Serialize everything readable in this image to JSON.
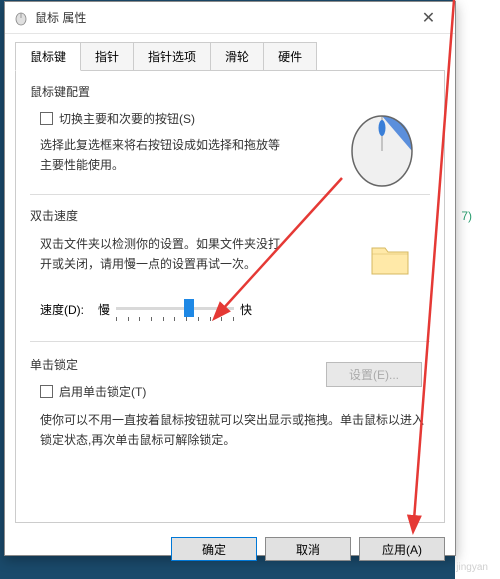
{
  "bg": {
    "hint": "7)"
  },
  "window": {
    "title": "鼠标 属性",
    "close": "✕"
  },
  "tabs": [
    "鼠标键",
    "指针",
    "指针选项",
    "滑轮",
    "硬件"
  ],
  "section1": {
    "title": "鼠标键配置",
    "checkbox": "切换主要和次要的按钮(S)",
    "desc": "选择此复选框来将右按钮设成如选择和拖放等主要性能使用。"
  },
  "section2": {
    "title": "双击速度",
    "desc": "双击文件夹以检测你的设置。如果文件夹没打开或关闭，请用慢一点的设置再试一次。",
    "speed_label": "速度(D):",
    "slow": "慢",
    "fast": "快"
  },
  "section3": {
    "title": "单击锁定",
    "checkbox": "启用单击锁定(T)",
    "settings": "设置(E)...",
    "desc": "使你可以不用一直按着鼠标按钮就可以突出显示或拖拽。单击鼠标以进入锁定状态,再次单击鼠标可解除锁定。"
  },
  "buttons": {
    "ok": "确定",
    "cancel": "取消",
    "apply": "应用(A)"
  },
  "watermark": "jingyan"
}
